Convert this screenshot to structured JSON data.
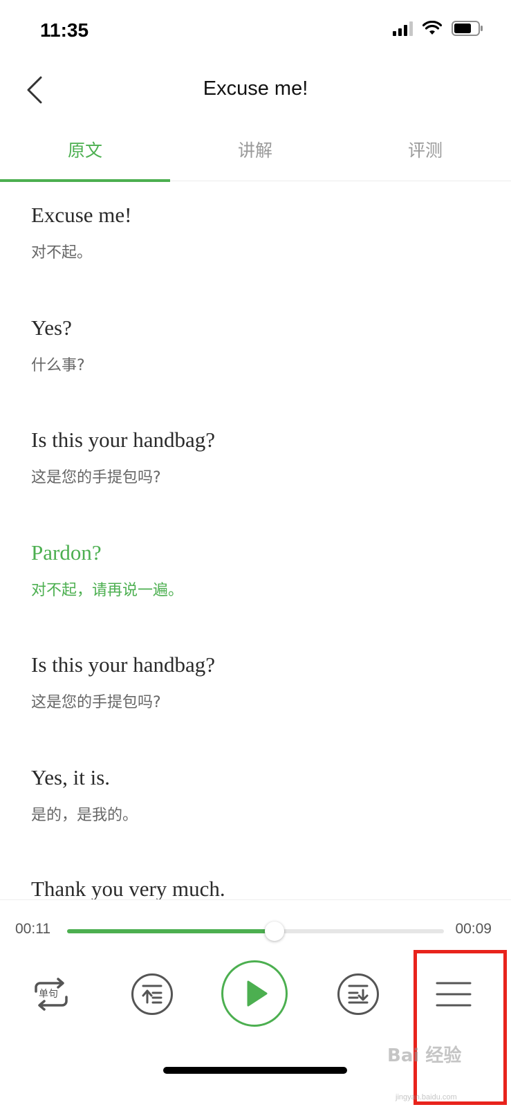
{
  "status_bar": {
    "time": "11:35",
    "signal_icon": "cellular-signal-icon",
    "wifi_icon": "wifi-icon",
    "battery_icon": "battery-icon"
  },
  "nav": {
    "back_icon": "chevron-left-icon",
    "title": "Excuse me!"
  },
  "tabs": [
    {
      "label": "原文",
      "active": true
    },
    {
      "label": "讲解",
      "active": false
    },
    {
      "label": "评测",
      "active": false
    }
  ],
  "sentences": [
    {
      "en": "Excuse me!",
      "zh": "对不起。"
    },
    {
      "en": "Yes?",
      "zh": "什么事?"
    },
    {
      "en": "Is this your handbag?",
      "zh": "这是您的手提包吗?"
    },
    {
      "en": "Pardon?",
      "zh": "对不起，请再说一遍。",
      "current": true
    },
    {
      "en": "Is this your handbag?",
      "zh": "这是您的手提包吗?"
    },
    {
      "en": "Yes, it is.",
      "zh": "是的，是我的。"
    },
    {
      "en": "Thank you very much.",
      "zh": ""
    }
  ],
  "player": {
    "elapsed": "00:11",
    "remaining": "00:09",
    "progress": 0.55,
    "repeat_label": "单句",
    "repeat_icon": "repeat-icon",
    "prev_icon": "previous-sentence-icon",
    "play_icon": "play-icon",
    "next_icon": "next-sentence-icon",
    "menu_icon": "menu-icon"
  },
  "watermark": {
    "text": "Bai 经验",
    "sub": "jingyan.baidu.com"
  },
  "colors": {
    "accent": "#4caf50",
    "highlight_box": "#e8231c"
  }
}
